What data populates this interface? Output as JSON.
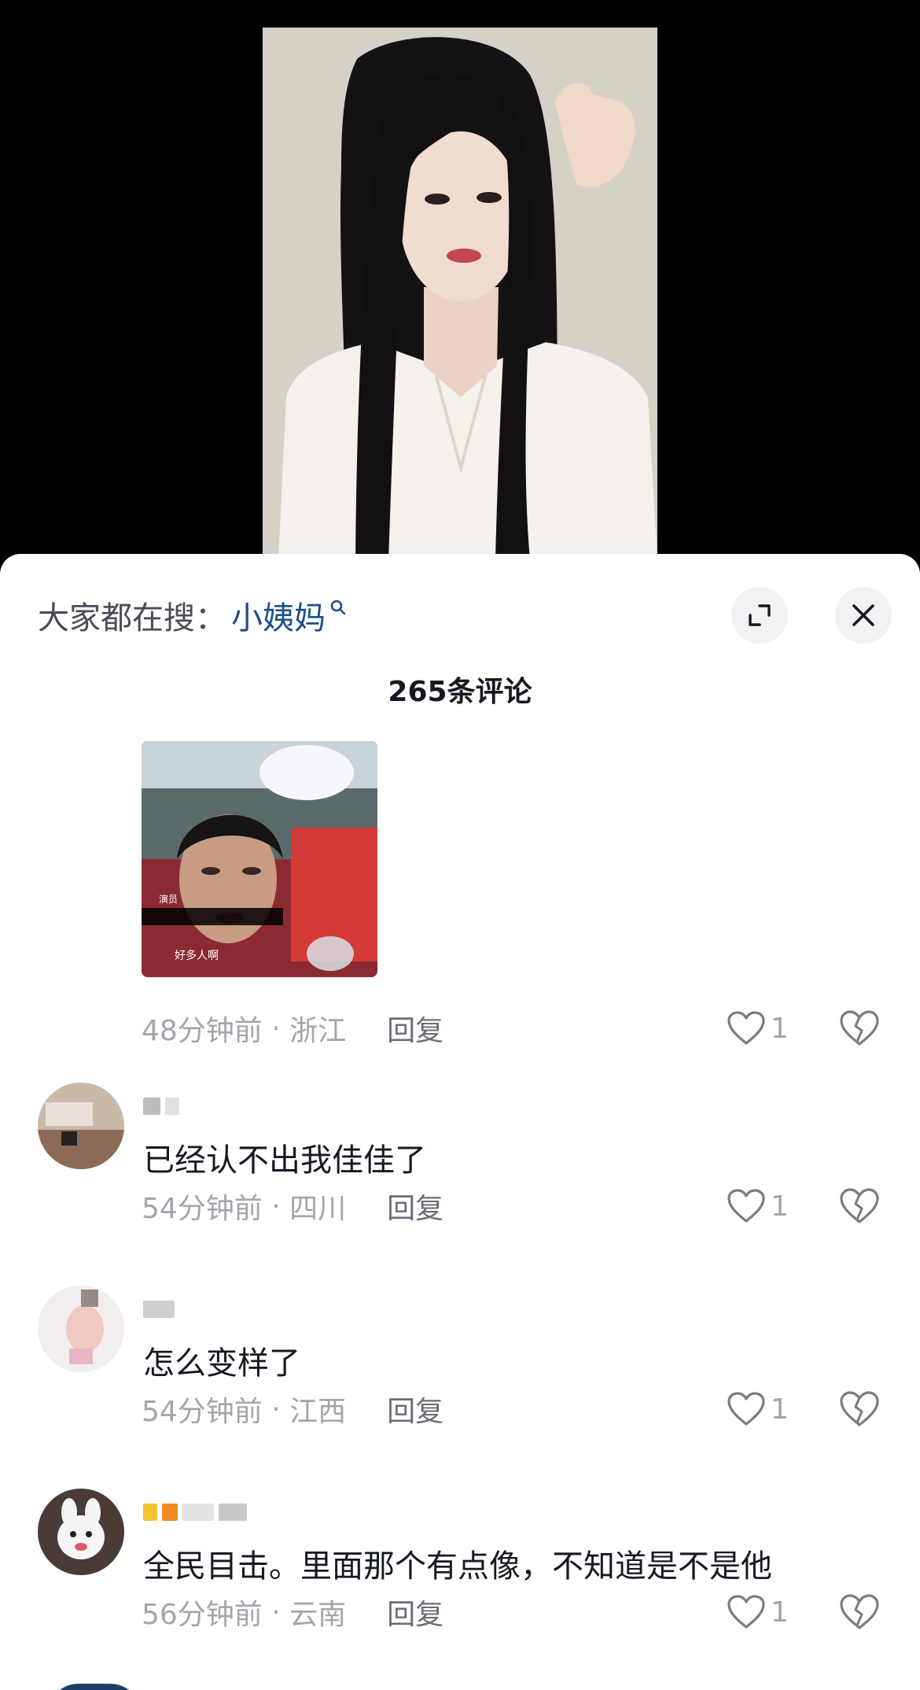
{
  "search_hint": {
    "prefix": "大家都在搜：",
    "term": "小姨妈"
  },
  "icons": {
    "search": "search-icon",
    "expand": "expand-icon",
    "close": "close-icon",
    "like": "heart-icon",
    "dislike": "broken-heart-icon"
  },
  "comments_header": {
    "count": "265",
    "label": "条评论"
  },
  "image_comment": {
    "tag": "演员",
    "caption": "好多人啊",
    "time": "48分钟前",
    "location": "浙江",
    "reply": "回复",
    "likes": "1"
  },
  "comments": [
    {
      "text": "已经认不出我佳佳了",
      "time": "54分钟前",
      "location": "四川",
      "reply": "回复",
      "likes": "1"
    },
    {
      "text": "怎么变样了",
      "time": "54分钟前",
      "location": "江西",
      "reply": "回复",
      "likes": "1"
    },
    {
      "text": "全民目击。里面那个有点像，不知道是不是他",
      "time": "56分钟前",
      "location": "云南",
      "reply": "回复",
      "likes": "1"
    }
  ],
  "colors": {
    "search_term": "#1e4f88",
    "meta_text": "#a3a5ab",
    "primary_text": "#161823"
  }
}
